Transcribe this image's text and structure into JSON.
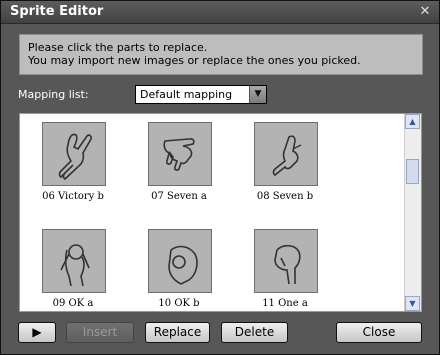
{
  "window": {
    "title": "Sprite Editor"
  },
  "instructions": {
    "line1": "Please click the parts to replace.",
    "line2": "You may import new images or replace the ones you picked."
  },
  "mapping": {
    "label": "Mapping list:",
    "selected": "Default mapping"
  },
  "sprites": [
    {
      "label": "06 Victory b",
      "icon": "victory-hand-icon"
    },
    {
      "label": "07 Seven a",
      "icon": "seven-hand-icon"
    },
    {
      "label": "08 Seven b",
      "icon": "seven-hand-icon"
    },
    {
      "label": "09 OK a",
      "icon": "ok-hand-icon"
    },
    {
      "label": "10 OK b",
      "icon": "ok-hand-icon"
    },
    {
      "label": "11 One a",
      "icon": "one-hand-icon"
    }
  ],
  "buttons": {
    "play": "▶",
    "insert": "Insert",
    "replace": "Replace",
    "delete": "Delete",
    "close": "Close"
  }
}
